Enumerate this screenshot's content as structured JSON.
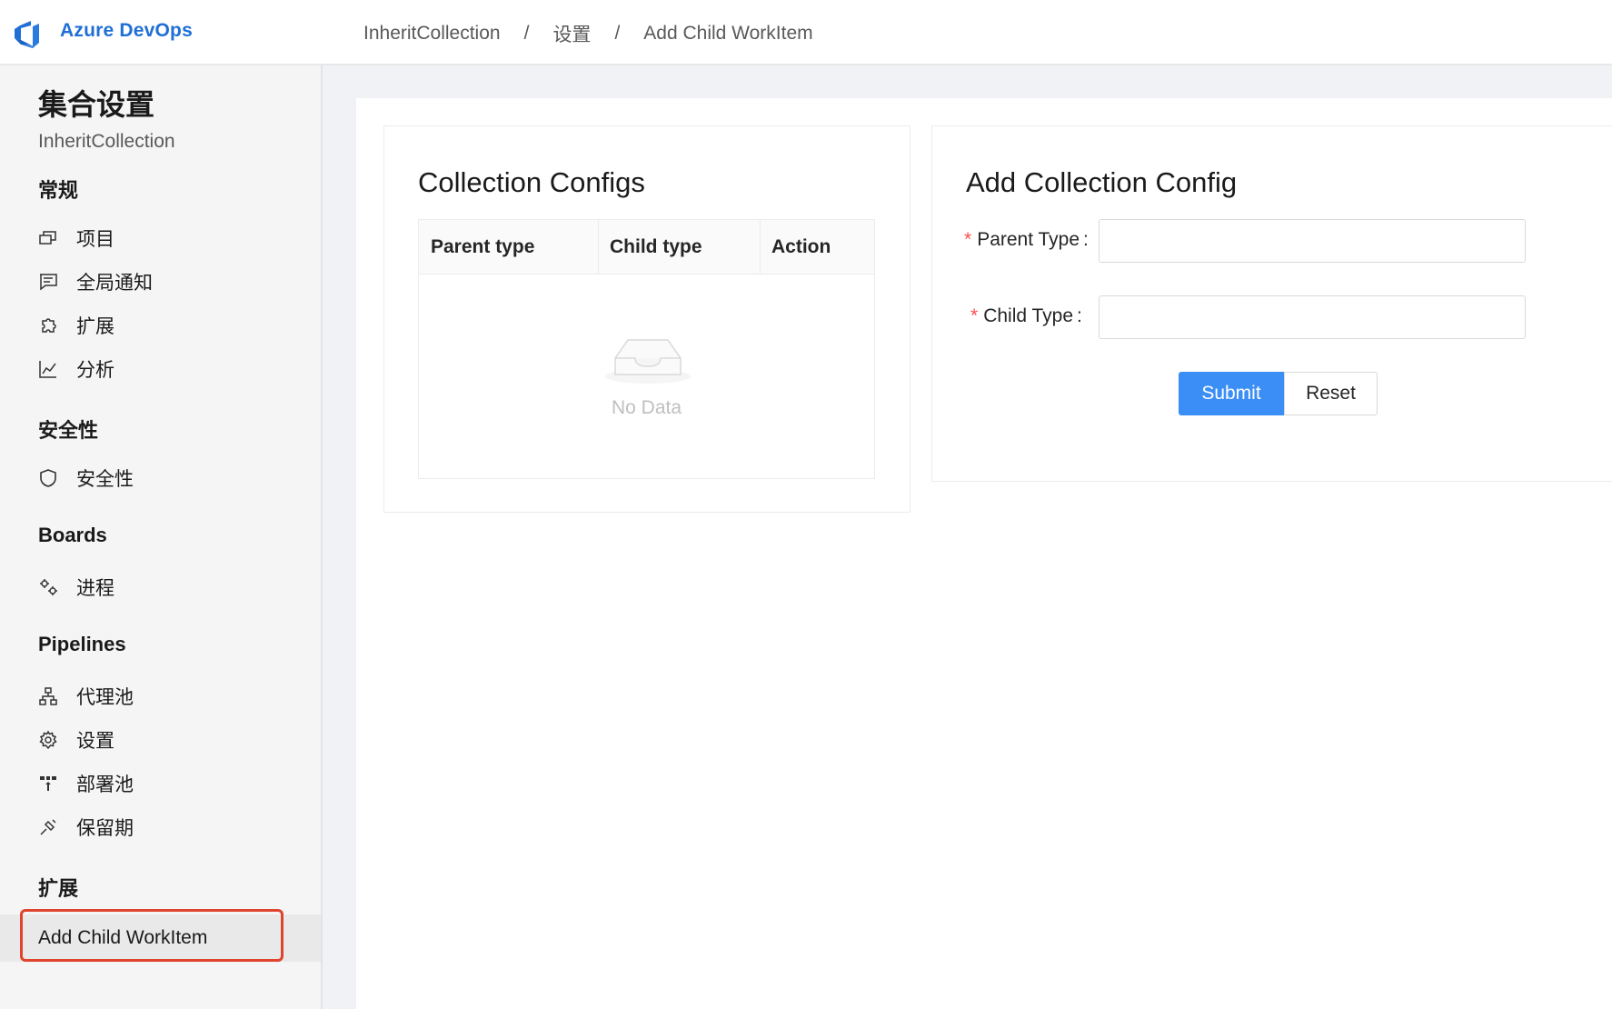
{
  "header": {
    "app_name": "Azure DevOps",
    "breadcrumb": [
      "InheritCollection",
      "设置",
      "Add Child WorkItem"
    ],
    "separator": "/"
  },
  "sidebar": {
    "title": "集合设置",
    "subtitle": "InheritCollection",
    "sections": [
      {
        "label": "常规",
        "items": [
          {
            "label": "项目",
            "icon": "projects-icon"
          },
          {
            "label": "全局通知",
            "icon": "comment-icon"
          },
          {
            "label": "扩展",
            "icon": "puzzle-icon"
          },
          {
            "label": "分析",
            "icon": "chart-icon"
          }
        ]
      },
      {
        "label": "安全性",
        "items": [
          {
            "label": "安全性",
            "icon": "shield-icon"
          }
        ]
      },
      {
        "label": "Boards",
        "items": [
          {
            "label": "进程",
            "icon": "process-icon"
          }
        ]
      },
      {
        "label": "Pipelines",
        "items": [
          {
            "label": "代理池",
            "icon": "agent-pool-icon"
          },
          {
            "label": "设置",
            "icon": "gear-icon"
          },
          {
            "label": "部署池",
            "icon": "deployment-pool-icon"
          },
          {
            "label": "保留期",
            "icon": "retention-icon"
          }
        ]
      },
      {
        "label": "扩展",
        "items": [
          {
            "label": "Add Child WorkItem",
            "active": true
          }
        ]
      }
    ]
  },
  "collection_configs": {
    "title": "Collection Configs",
    "columns": [
      "Parent type",
      "Child type",
      "Action"
    ],
    "rows": [],
    "empty_text": "No Data"
  },
  "add_form": {
    "title": "Add Collection Config",
    "parent_type_label": "Parent Type",
    "parent_type_value": "",
    "child_type_label": "Child Type",
    "child_type_value": "",
    "required_mark": "*",
    "colon": ":",
    "submit_label": "Submit",
    "reset_label": "Reset"
  },
  "colors": {
    "brand": "#1f6fd6",
    "primary_button": "#3a8ef6",
    "required": "#ff4d4f",
    "highlight_box": "#e0442d"
  }
}
